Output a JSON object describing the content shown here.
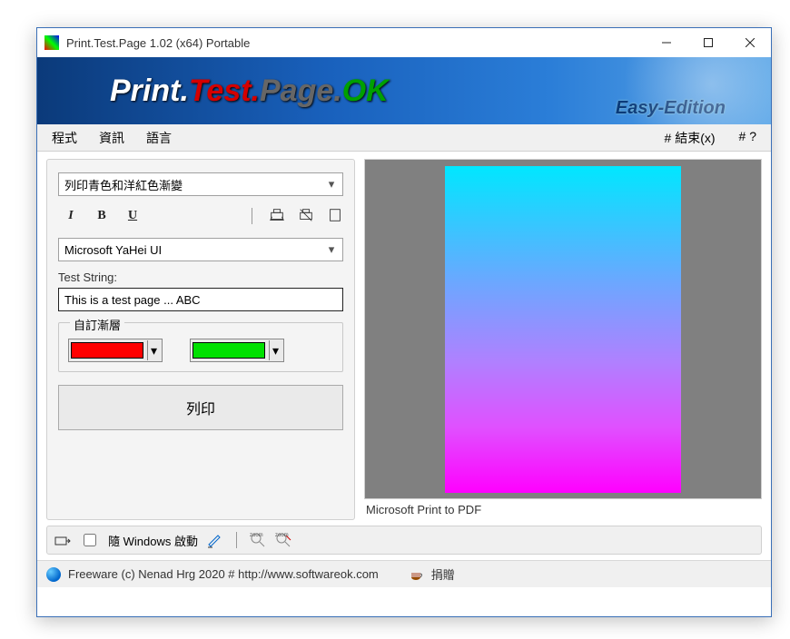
{
  "titlebar": {
    "title": "Print.Test.Page 1.02  (x64) Portable"
  },
  "banner": {
    "p1": "Print.",
    "p2": "Test.",
    "p3": "Page.",
    "p4": "OK",
    "edition": "Easy-Edition"
  },
  "menubar": {
    "items": [
      "程式",
      "資訊",
      "語言"
    ],
    "right": [
      "# 結束(x)",
      "# ?"
    ]
  },
  "controls": {
    "mode_combo": "列印青色和洋紅色漸變",
    "font_combo": "Microsoft YaHei UI",
    "test_label": "Test String:",
    "test_value": "This is a test page ... ABC",
    "gradient_label": "自訂漸層",
    "color1": "#ff0000",
    "color2": "#00e000",
    "print_button": "列印"
  },
  "preview": {
    "printer_name": "Microsoft Print to PDF",
    "gradient_top": "#00e7ff",
    "gradient_bottom": "#ff00ff"
  },
  "bottombar": {
    "autostart_label": "隨 Windows 啟動",
    "autostart_checked": false
  },
  "statusbar": {
    "text": "Freeware (c) Nenad Hrg 2020 # http://www.softwareok.com",
    "donate": "捐贈"
  }
}
